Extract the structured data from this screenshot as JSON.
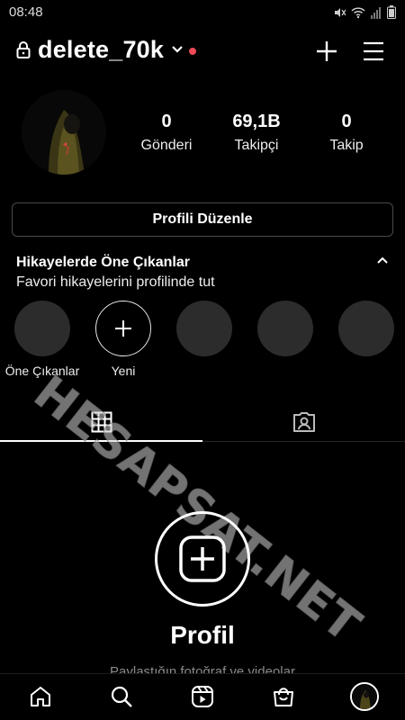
{
  "status_bar": {
    "time": "08:48"
  },
  "header": {
    "username": "delete_70k",
    "notification_color": "#ed4956"
  },
  "stats": [
    {
      "value": "0",
      "label": "Gönderi"
    },
    {
      "value": "69,1B",
      "label": "Takipçi"
    },
    {
      "value": "0",
      "label": "Takip"
    }
  ],
  "edit_profile_label": "Profili Düzenle",
  "highlights": {
    "title": "Hikayelerde Öne Çıkanlar",
    "subtitle": "Favori hikayelerini profilinde tut",
    "items": [
      {
        "label": "Öne Çıkanlar"
      },
      {
        "label": "Yeni"
      }
    ]
  },
  "tabs": [
    {
      "icon": "grid-icon",
      "active": true
    },
    {
      "icon": "tagged-icon",
      "active": false
    }
  ],
  "empty_state": {
    "title": "Profil",
    "subtitle": "Paylaştığın fotoğraf ve videolar"
  },
  "watermark": "HESAPSAT.NET",
  "bottom_nav": [
    {
      "icon": "home-icon"
    },
    {
      "icon": "search-icon"
    },
    {
      "icon": "reels-icon"
    },
    {
      "icon": "shop-icon"
    },
    {
      "icon": "profile-avatar"
    }
  ]
}
